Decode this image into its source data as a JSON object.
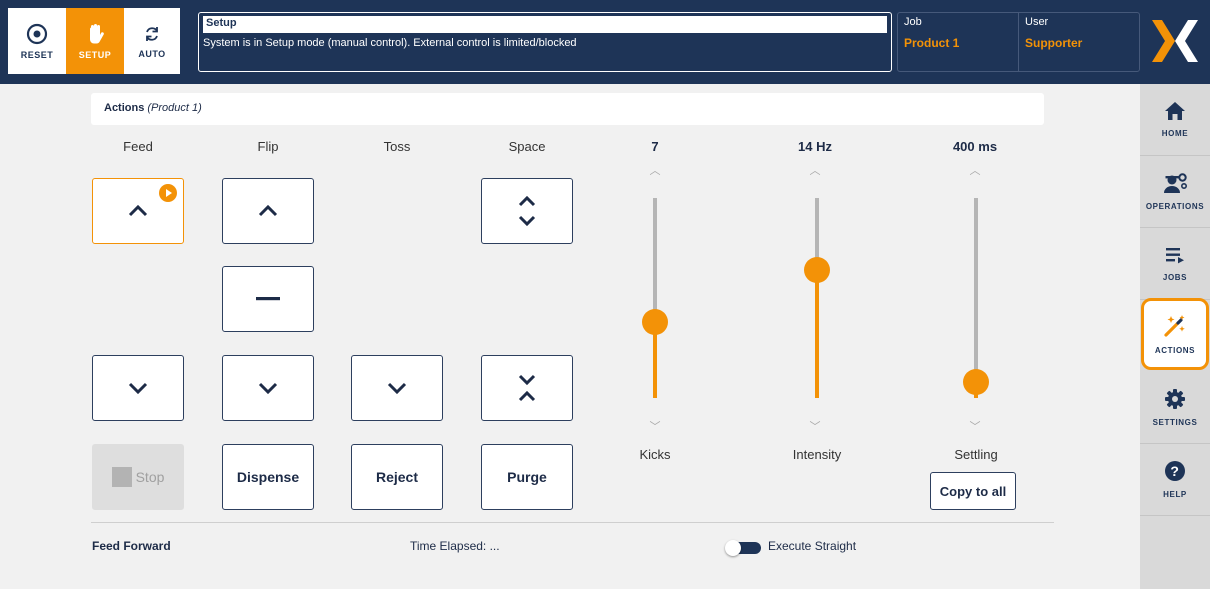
{
  "topbar": {
    "modes": [
      {
        "label": "RESET",
        "icon": "target-icon",
        "active": false
      },
      {
        "label": "SETUP",
        "icon": "hand-icon",
        "active": true
      },
      {
        "label": "AUTO",
        "icon": "refresh-icon",
        "active": false
      }
    ],
    "status_title": "Setup",
    "status_message": "System is in Setup mode (manual control). External control is limited/blocked",
    "job_label": "Job",
    "job_value": "Product 1",
    "user_label": "User",
    "user_value": "Supporter"
  },
  "sidenav": {
    "items": [
      {
        "label": "HOME",
        "icon": "home-icon"
      },
      {
        "label": "OPERATIONS",
        "icon": "operations-icon"
      },
      {
        "label": "JOBS",
        "icon": "jobs-list-icon"
      },
      {
        "label": "ACTIONS",
        "icon": "magic-wand-icon",
        "active": true
      },
      {
        "label": "SETTINGS",
        "icon": "gear-icon"
      },
      {
        "label": "HELP",
        "icon": "help-icon"
      }
    ]
  },
  "actions": {
    "title": "Actions",
    "subtitle": "(Product 1)",
    "columns": [
      "Feed",
      "Flip",
      "Toss",
      "Space"
    ],
    "stop_label": "Stop",
    "dispense_label": "Dispense",
    "reject_label": "Reject",
    "purge_label": "Purge"
  },
  "sliders": [
    {
      "label": "Kicks",
      "value_text": "7",
      "level": 0.38
    },
    {
      "label": "Intensity",
      "value_text": "14 Hz",
      "level": 0.64
    },
    {
      "label": "Settling",
      "value_text": "400 ms",
      "level": 0.08
    }
  ],
  "copy_to_all_label": "Copy to all",
  "footer": {
    "feed_forward": "Feed Forward",
    "time_elapsed": "Time Elapsed: ...",
    "execute_straight": "Execute Straight"
  },
  "colors": {
    "brand_navy": "#1e3457",
    "accent_orange": "#f39207"
  }
}
